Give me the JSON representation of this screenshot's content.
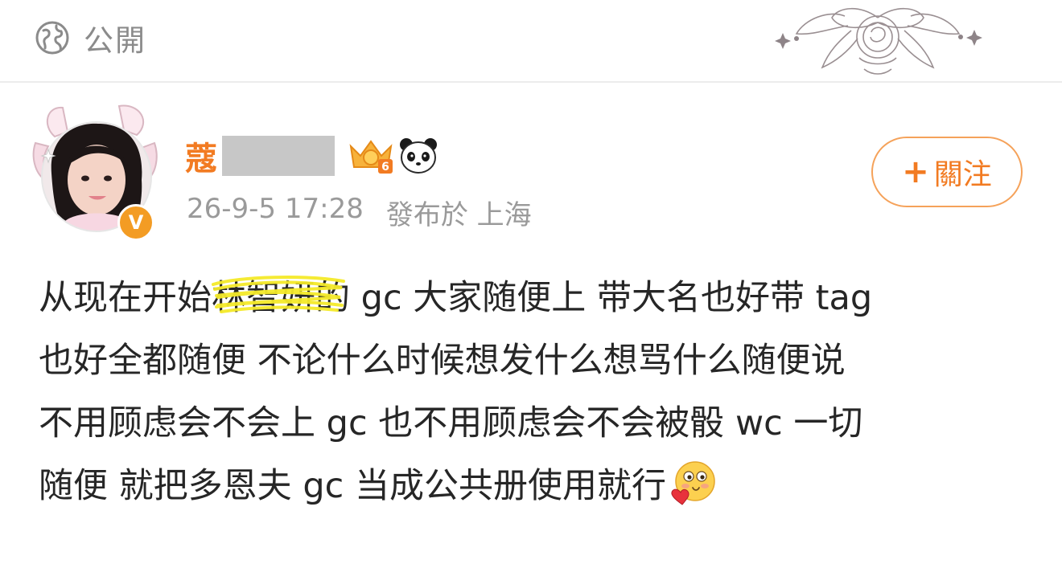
{
  "header": {
    "visibility_label": "公開",
    "icons": {
      "visibility": "globe-icon",
      "decoration": "ornament-bow-icon"
    }
  },
  "author": {
    "name": "蔻",
    "name_redacted": true,
    "badges": [
      "crown-level-6-icon",
      "panda-icon"
    ],
    "crown_level": "6",
    "verified_badge": "V",
    "timestamp": "26-9-5 17:28",
    "location": "發布於 上海",
    "colors": {
      "name": "#f27b22",
      "badge": "#f39c24"
    }
  },
  "follow_button": {
    "plus": "+",
    "label": "關注"
  },
  "post": {
    "line1_start": "从现在开始",
    "line1_scribbled": "林智妍",
    "line1_end": "的 gc 大家随便上 带大名也好带 tag",
    "line2": "也好全都随便 不论什么时候想发什么想骂什么随便说",
    "line3": "不用顾虑会不会上 gc 也不用顾虑会不会被骰 wc 一切",
    "line4": "随便 就把多恩夫 gc 当成公共册使用就行",
    "emoji": "blushing-heart-emoji",
    "scribble_color": "#f5ea2a"
  }
}
